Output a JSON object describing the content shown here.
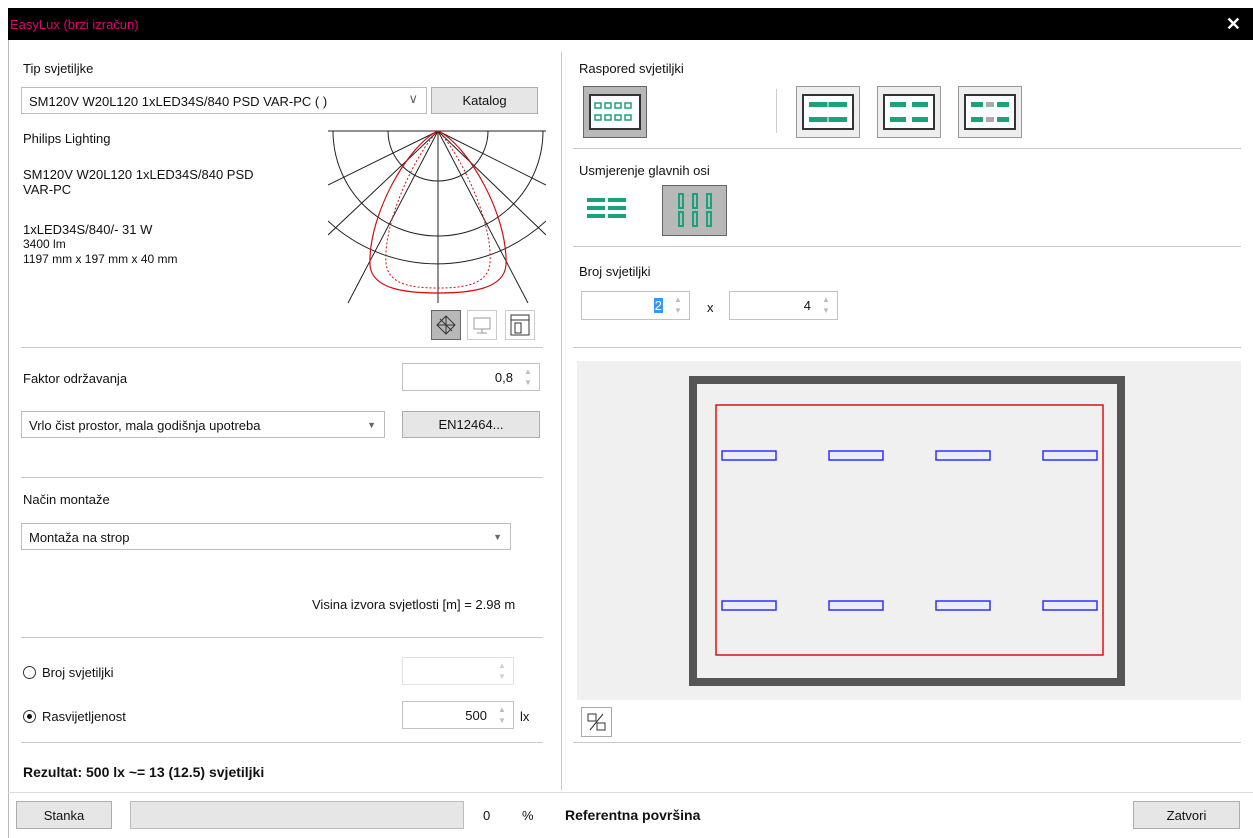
{
  "window": {
    "title": "EasyLux (brzi izračun)",
    "close_glyph": "✕"
  },
  "luminaire": {
    "section_label": "Tip svjetiljke",
    "selected": "SM120V W20L120 1xLED34S/840 PSD VAR-PC ( )",
    "catalog_button": "Katalog",
    "manufacturer": "Philips Lighting",
    "name_line1": "SM120V W20L120 1xLED34S/840 PSD",
    "name_line2": "VAR-PC",
    "lamp": "1xLED34S/840/- 31 W",
    "flux": "3400 lm",
    "dimensions": "1197 mm x 197 mm x 40 mm",
    "view_icons": [
      "polar-diagram-icon",
      "monitor-icon",
      "room-icon"
    ]
  },
  "maintenance": {
    "label": "Faktor održavanja",
    "value": "0,8",
    "preset": "Vrlo čist prostor, mala godišnja upotreba",
    "standard_button": "EN12464..."
  },
  "mounting": {
    "label": "Način montaže",
    "value": "Montaža na strop",
    "height_text": "Visina izvora svjetlosti [m] = 2.98 m"
  },
  "calc_mode": {
    "option_count": "Broj svjetiljki",
    "option_illuminance": "Rasvijetljenost",
    "selected": "illuminance",
    "illuminance_value": "500",
    "unit": "lx"
  },
  "result": {
    "text": "Rezultat: 500 lx ~= 13 (12.5) svjetiljki"
  },
  "arrangement": {
    "label": "Raspored svjetiljki",
    "orientation_label": "Usmjerenje glavnih osi",
    "count_label": "Broj svjetiljki",
    "rows": "2",
    "times": "x",
    "cols": "4",
    "colors": {
      "accent": "#1aa37a",
      "room_wall": "#555555",
      "boundary": "#e01010",
      "luminaire": "#3030ff"
    }
  },
  "preview": {
    "rows": 2,
    "cols": 4
  },
  "footer": {
    "pause_button": "Stanka",
    "progress_percent": 0,
    "progress_value": "0",
    "percent_sign": "%",
    "reference_label": "Referentna površina",
    "close_button": "Zatvori"
  }
}
